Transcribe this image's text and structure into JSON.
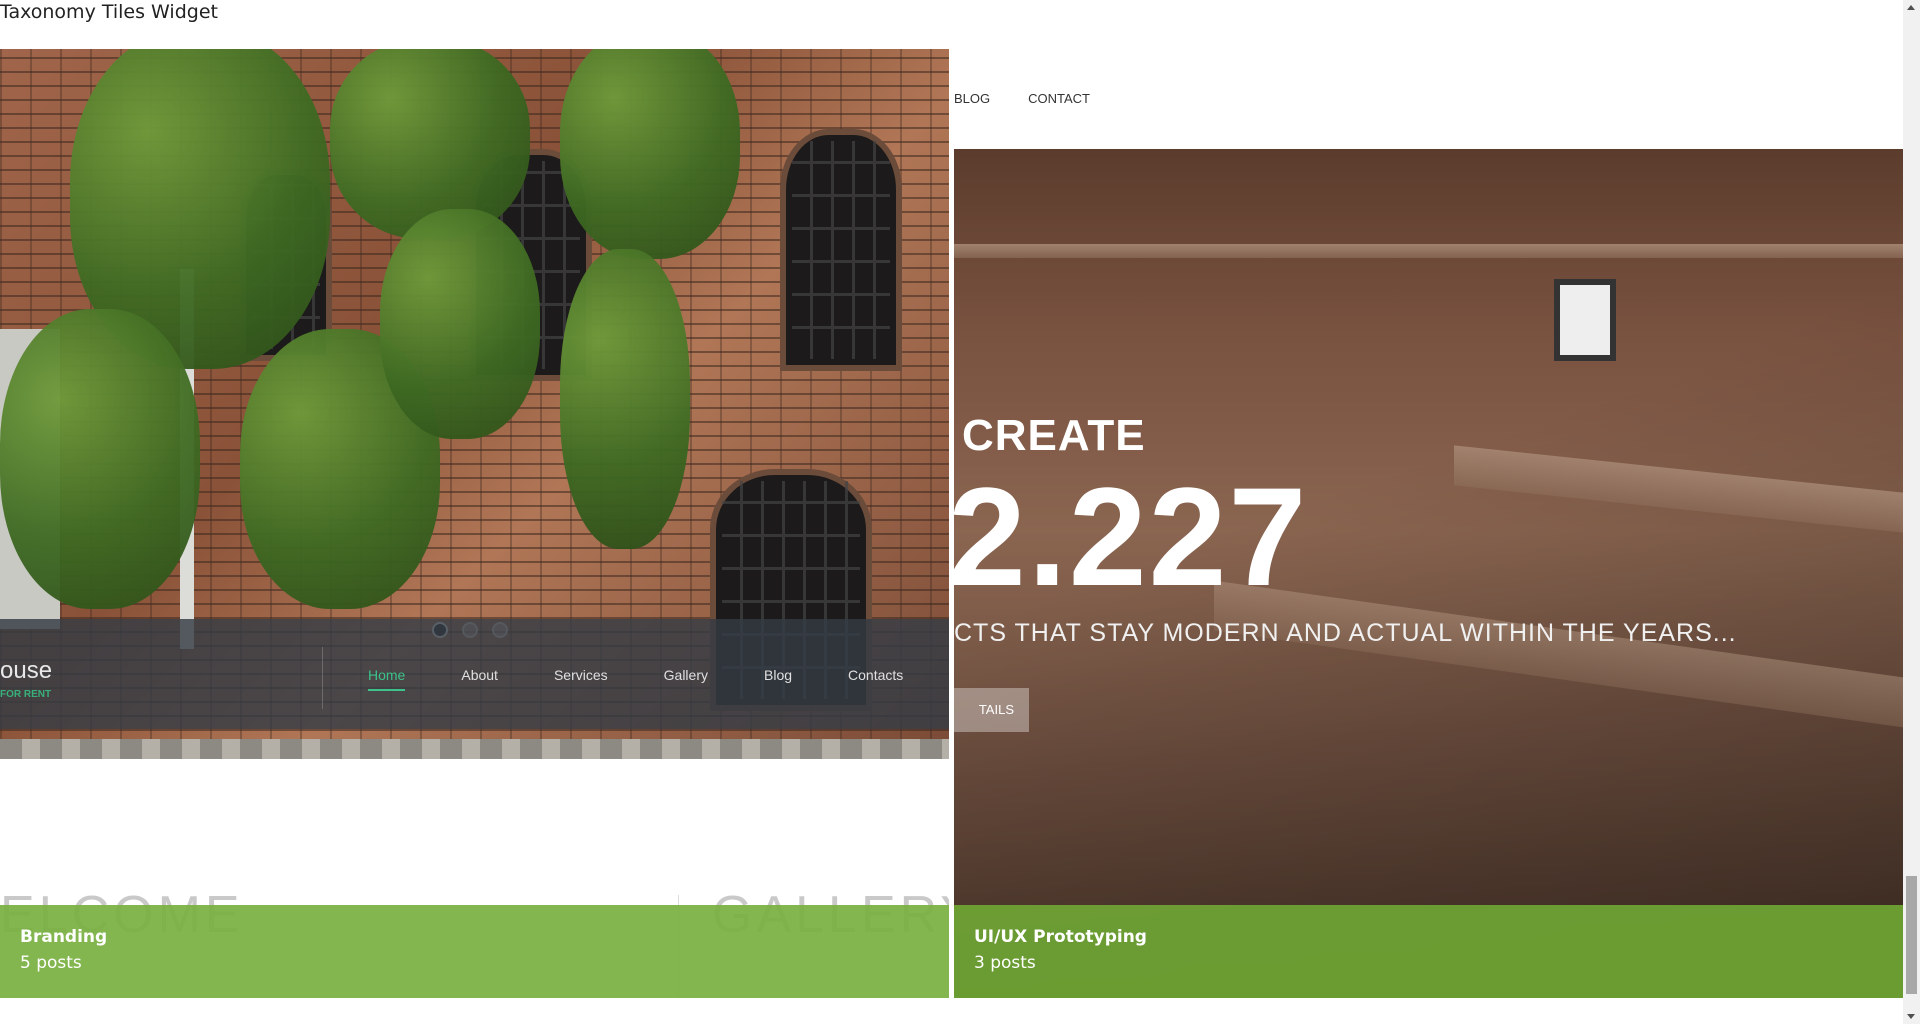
{
  "widget": {
    "title": "Taxonomy Tiles Widget"
  },
  "tiles": [
    {
      "title": "Branding",
      "count": "5 posts",
      "preview": {
        "brand": "ouse",
        "brand_sub": "FOR RENT",
        "nav": [
          "Home",
          "About",
          "Services",
          "Gallery",
          "Blog",
          "Contacts"
        ],
        "active_nav": "Home",
        "heading_left": "ELCOME",
        "heading_right": "GALLERY"
      }
    },
    {
      "title": "UI/UX Prototyping",
      "count": "3 posts",
      "preview": {
        "topnav": [
          "BLOG",
          "CONTACT"
        ],
        "stat_label": "CREATE",
        "stat_value": "2.227",
        "stat_sub": "CTS THAT STAY MODERN AND ACTUAL WITHIN THE YEARS...",
        "button": "TAILS"
      }
    }
  ],
  "colors": {
    "caption": "#7ab042",
    "active_nav": "#3cc28a"
  }
}
